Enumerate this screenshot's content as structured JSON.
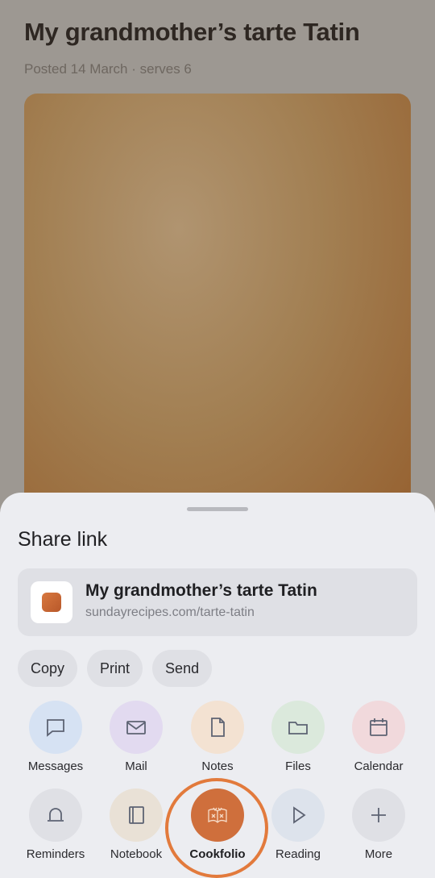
{
  "page": {
    "title": "My grandmother’s tarte Tatin",
    "meta": "Posted 14 March · serves 6"
  },
  "sheet": {
    "title": "Share link",
    "link": {
      "title": "My grandmother’s tarte Tatin",
      "url": "sundayrecipes.com/tarte-tatin"
    },
    "actions": [
      "Copy",
      "Print",
      "Send"
    ],
    "apps_row1": [
      {
        "label": "Messages",
        "icon": "message-icon"
      },
      {
        "label": "Mail",
        "icon": "mail-icon"
      },
      {
        "label": "Notes",
        "icon": "note-icon"
      },
      {
        "label": "Files",
        "icon": "folder-icon"
      },
      {
        "label": "Calendar",
        "icon": "calendar-icon"
      }
    ],
    "apps_row2": [
      {
        "label": "Reminders",
        "icon": "bell-icon"
      },
      {
        "label": "Notebook",
        "icon": "notebook-icon"
      },
      {
        "label": "Cookfolio",
        "icon": "cookbook-icon"
      },
      {
        "label": "Reading",
        "icon": "play-icon"
      },
      {
        "label": "More",
        "icon": "plus-icon"
      }
    ]
  },
  "colors": {
    "accent": "#e27a3c",
    "cookfolio": "#cf6f3c"
  }
}
